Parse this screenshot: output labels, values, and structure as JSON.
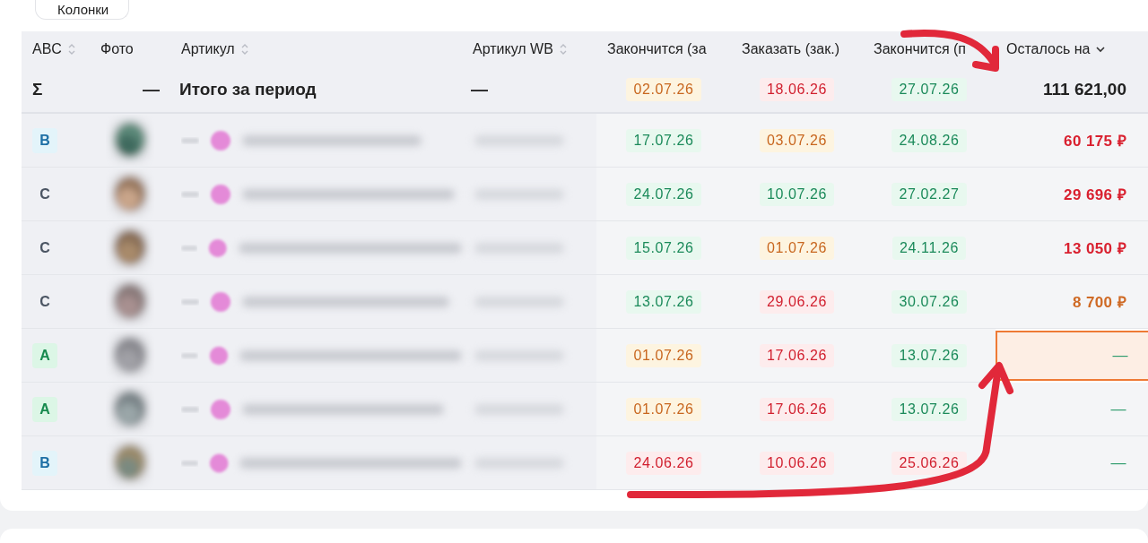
{
  "toolbar": {
    "columns_button": "Колонки"
  },
  "table": {
    "columns": [
      {
        "label": "ABC",
        "sortable": true
      },
      {
        "label": "Фото"
      },
      {
        "label": "Артикул",
        "sortable": true
      },
      {
        "label": "Артикул WB",
        "sortable": true
      },
      {
        "label": "Закончится (за"
      },
      {
        "label": "Заказать (зак.)"
      },
      {
        "label": "Закончится (п"
      },
      {
        "label": "Осталось на",
        "dropdown": true
      }
    ],
    "total": {
      "symbol": "Σ",
      "photo": "—",
      "title": "Итого за период",
      "wb": "—",
      "dates": [
        {
          "text": "02.07.26",
          "color": "#c8661e"
        },
        {
          "text": "18.06.26",
          "color": "#d11f2e"
        },
        {
          "text": "27.07.26",
          "color": "#1b8a5a"
        }
      ],
      "amount": "111 621,00"
    },
    "rows": [
      {
        "abc": {
          "text": "B",
          "color": "#1d6fa5"
        },
        "dates": [
          {
            "text": "17.07.26",
            "color": "#1b8a5a"
          },
          {
            "text": "03.07.26",
            "color": "#c8661e"
          },
          {
            "text": "24.08.26",
            "color": "#1b8a5a"
          }
        ],
        "amount": {
          "text": "60 175 ₽",
          "color": "#d9202f",
          "highlighted": false
        }
      },
      {
        "abc": {
          "text": "C",
          "color": "#4b5563"
        },
        "dates": [
          {
            "text": "24.07.26",
            "color": "#1b8a5a"
          },
          {
            "text": "10.07.26",
            "color": "#1b8a5a"
          },
          {
            "text": "27.02.27",
            "color": "#1b8a5a"
          }
        ],
        "amount": {
          "text": "29 696 ₽",
          "color": "#d9202f",
          "highlighted": false
        }
      },
      {
        "abc": {
          "text": "C",
          "color": "#4b5563"
        },
        "dates": [
          {
            "text": "15.07.26",
            "color": "#1b8a5a"
          },
          {
            "text": "01.07.26",
            "color": "#c8661e"
          },
          {
            "text": "24.11.26",
            "color": "#1b8a5a"
          }
        ],
        "amount": {
          "text": "13 050 ₽",
          "color": "#d9202f",
          "highlighted": false
        }
      },
      {
        "abc": {
          "text": "C",
          "color": "#4b5563"
        },
        "dates": [
          {
            "text": "13.07.26",
            "color": "#1b8a5a"
          },
          {
            "text": "29.06.26",
            "color": "#d11f2e"
          },
          {
            "text": "30.07.26",
            "color": "#1b8a5a"
          }
        ],
        "amount": {
          "text": "8 700 ₽",
          "color": "#cf6a25",
          "highlighted": false
        }
      },
      {
        "abc": {
          "text": "A",
          "color": "#178a4e"
        },
        "dates": [
          {
            "text": "01.07.26",
            "color": "#c8661e"
          },
          {
            "text": "17.06.26",
            "color": "#d11f2e"
          },
          {
            "text": "13.07.26",
            "color": "#1b8a5a"
          }
        ],
        "amount": {
          "text": "—",
          "color": "#2b9a6a",
          "highlighted": true
        }
      },
      {
        "abc": {
          "text": "A",
          "color": "#178a4e"
        },
        "dates": [
          {
            "text": "01.07.26",
            "color": "#c8661e"
          },
          {
            "text": "17.06.26",
            "color": "#d11f2e"
          },
          {
            "text": "13.07.26",
            "color": "#1b8a5a"
          }
        ],
        "amount": {
          "text": "—",
          "color": "#2b9a6a",
          "highlighted": false
        }
      },
      {
        "abc": {
          "text": "B",
          "color": "#1d6fa5"
        },
        "dates": [
          {
            "text": "24.06.26",
            "color": "#d11f2e"
          },
          {
            "text": "10.06.26",
            "color": "#d11f2e"
          },
          {
            "text": "25.06.26",
            "color": "#d11f2e"
          }
        ],
        "amount": {
          "text": "—",
          "color": "#2b9a6a",
          "highlighted": false
        }
      }
    ]
  },
  "annotations": [
    {
      "kind": "arrow"
    },
    {
      "kind": "arrow"
    }
  ]
}
